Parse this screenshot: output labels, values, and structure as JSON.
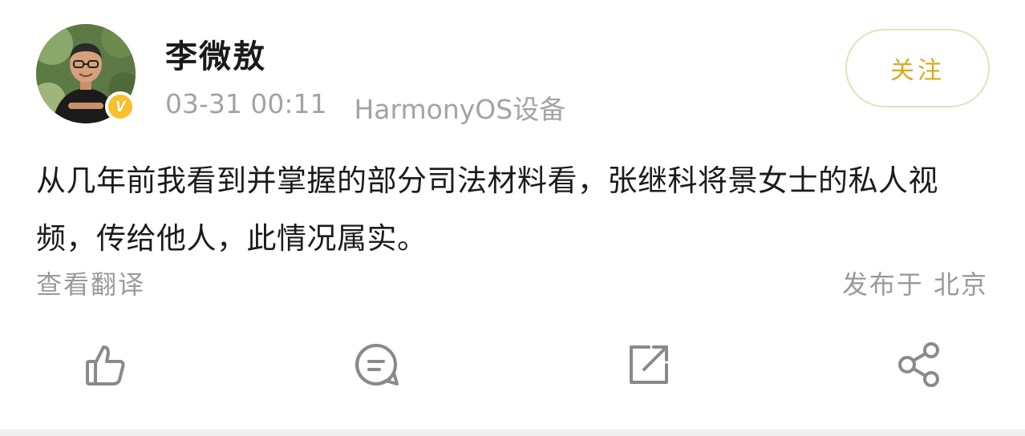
{
  "post": {
    "username": "李微敖",
    "time": "03-31 00:11",
    "device": "HarmonyOS设备",
    "follow_label": "关注",
    "verified_mark": "V",
    "content_line1": "从几年前我看到并掌握的部分司法材料看，张继科将景女士的私人视",
    "content_line2": "频，传给他人，此情况属实。",
    "translate_label": "查看翻译",
    "location_label": "发布于 北京"
  },
  "actions": [
    {
      "icon": "like-icon"
    },
    {
      "icon": "comment-icon"
    },
    {
      "icon": "repost-icon"
    },
    {
      "icon": "share-icon"
    }
  ],
  "colors": {
    "accent": "#d9a91c",
    "verified": "#f7c02c",
    "muted_text": "#a3a3a3",
    "icon": "#8a8a8a"
  }
}
